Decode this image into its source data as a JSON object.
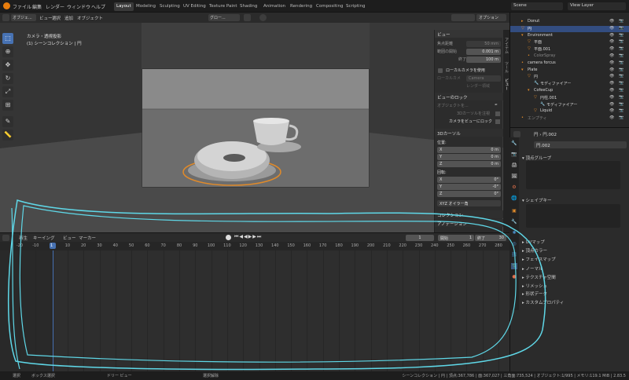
{
  "topbar": {
    "menus": [
      "ファイル",
      "編集",
      "レンダー",
      "ウィンドウ",
      "ヘルプ"
    ],
    "workspaces": [
      "Layout",
      "Modeling",
      "Sculpting",
      "UV Editing",
      "Texture Paint",
      "Shading",
      "Animation",
      "Rendering",
      "Compositing",
      "Scripting"
    ],
    "active_workspace": "Layout",
    "scene": "Scene",
    "view_layer": "View Layer"
  },
  "viewport": {
    "mode": "オブジェ...",
    "menus": [
      "ビュー",
      "選択",
      "追加",
      "オブジェクト"
    ],
    "orientation": "グロー...",
    "options": "オプション",
    "info1": "カメラ・透視投影",
    "info2": "(1) シーンコレクション | 円"
  },
  "npanel": {
    "view_section": "ビュー",
    "focal_label": "焦点距離",
    "focal_value": "50 mm",
    "clip_start_label": "範囲の開始",
    "clip_start_value": "0.001 m",
    "clip_end_label": "終了",
    "clip_end_value": "100 m",
    "local_camera_toggle": "ローカルカメラを使用",
    "local_camera_label": "ローカルカメ",
    "local_camera_value": "Camera",
    "render_region": "レンダー領域",
    "lock_section": "ビューのロック",
    "lock_object_label": "オブジェクトを...",
    "lock_cursor": "3Dカーソルを注視",
    "lock_camera": "カメラをビューにロック",
    "cursor_section": "3Dカーソル",
    "location_label": "位置:",
    "rotation_label": "回転:",
    "x": "X",
    "y": "Y",
    "z": "Z",
    "loc_x": "0 m",
    "loc_y": "0 m",
    "loc_z": "0 m",
    "rot_x": "0°",
    "rot_y": "-0°",
    "rot_z": "0°",
    "euler": "XYZ オイラー角",
    "collection_section": "コレクション",
    "annotation_section": "アノテーション",
    "tabs": [
      "アイテム",
      "ツール",
      "ビュー"
    ]
  },
  "timeline": {
    "menus": [
      "再生",
      "キーイング",
      "ビュー",
      "マーカー"
    ],
    "current_frame": "1",
    "start_label": "開始",
    "start_value": "1",
    "end_label": "終了",
    "end_value": "30",
    "ticks": [
      "-20",
      "-10",
      "1",
      "10",
      "20",
      "30",
      "40",
      "50",
      "60",
      "70",
      "80",
      "90",
      "100",
      "110",
      "120",
      "130",
      "140",
      "150",
      "160",
      "170",
      "180",
      "190",
      "200",
      "210",
      "220",
      "230",
      "240",
      "250",
      "260",
      "270",
      "280"
    ]
  },
  "outliner": {
    "rows": [
      {
        "name": "Donut",
        "indent": 1,
        "icon": "▸",
        "color": "#d9d9d9"
      },
      {
        "name": "円",
        "indent": 1,
        "icon": "▽",
        "color": "#ffffff",
        "selected": true
      },
      {
        "name": "Environment",
        "indent": 1,
        "icon": "▾",
        "color": "#d9d9d9"
      },
      {
        "name": "平面",
        "indent": 2,
        "icon": "▽",
        "color": "#d9d9d9"
      },
      {
        "name": "平面.001",
        "indent": 2,
        "icon": "▽",
        "color": "#d9d9d9"
      },
      {
        "name": "ColorSpray",
        "indent": 2,
        "icon": "•",
        "color": "#888888"
      },
      {
        "name": "camera forcus",
        "indent": 1,
        "icon": "•",
        "color": "#d9d9d9"
      },
      {
        "name": "Plate",
        "indent": 1,
        "icon": "▾",
        "color": "#d9d9d9"
      },
      {
        "name": "円",
        "indent": 2,
        "icon": "▽",
        "color": "#d9d9d9"
      },
      {
        "name": "モディファイアー",
        "indent": 3,
        "icon": "🔧",
        "color": "#d9d9d9"
      },
      {
        "name": "CofeeCup",
        "indent": 2,
        "icon": "▾",
        "color": "#d9d9d9"
      },
      {
        "name": "円柱.001",
        "indent": 3,
        "icon": "▽",
        "color": "#d9d9d9"
      },
      {
        "name": "モディファイアー",
        "indent": 4,
        "icon": "🔧",
        "color": "#d9d9d9"
      },
      {
        "name": "Liquid",
        "indent": 3,
        "icon": "▽",
        "color": "#d9d9d9"
      },
      {
        "name": "エンプティ",
        "indent": 1,
        "icon": "•",
        "color": "#888888"
      }
    ]
  },
  "properties": {
    "object": "円",
    "data": "円.002",
    "mesh_name": "円.002",
    "sections": [
      "頂点グループ",
      "シェイプキー",
      "UVマップ",
      "頂点カラー",
      "フェイスマップ",
      "ノーマル",
      "テクスチャ空間",
      "リメッシュ",
      "形状データ",
      "カスタムプロパティ"
    ]
  },
  "statusbar": {
    "left": [
      "選択",
      "ボックス選択",
      "ドリー ビュー",
      "選択解除"
    ],
    "right": "シーンコレクション | 円 | 頂点:367,786 | 面:367,027 | 三角面:735,524 | オブジェクト:1/995 | メモリ:119.1 MiB | 2.83.5"
  },
  "colors": {
    "accent": "#4772b3",
    "selection_orange": "#e08a2a",
    "annotation_cyan": "#5fd8e8"
  }
}
